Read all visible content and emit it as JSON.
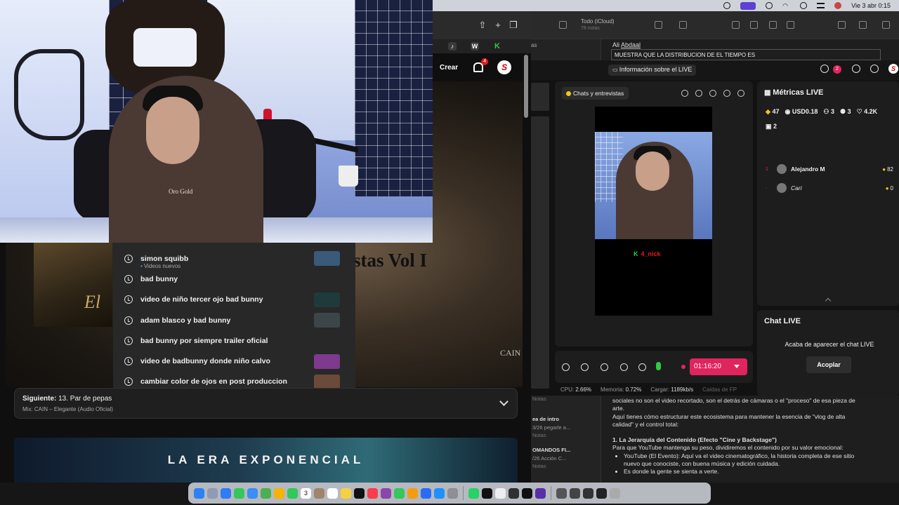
{
  "menubar": {
    "datetime": "Vie 3 abr 0:15"
  },
  "youtube": {
    "create_label": "Crear",
    "notifications_count": "4",
    "avatar_letter": "S",
    "bookmark_w": "W",
    "bookmark_k": "K",
    "suggestions": [
      {
        "text": "simon squibb",
        "sub": "Videos nuevos",
        "thumb": "#3b5a7a"
      },
      {
        "text": "bad bunny",
        "sub": "",
        "thumb": ""
      },
      {
        "text": "video de niño tercer ojo bad bunny",
        "sub": "",
        "thumb": "#1f3a3a"
      },
      {
        "text": "adam blasco y bad bunny",
        "sub": "",
        "thumb": "#3c4648"
      },
      {
        "text": "bad bunny por siempre trailer oficial",
        "sub": "",
        "thumb": ""
      },
      {
        "text": "video de badbunny donde niño calvo",
        "sub": "",
        "thumb": "#7d3a8f"
      },
      {
        "text": "cambiar color de ojos en post produccion",
        "sub": "",
        "thumb": "#6b4a3a"
      }
    ],
    "video_overlay_title": "stas Vol I",
    "video_art_text": "El",
    "video_watermark": "CAIN",
    "next": {
      "label": "Siguiente:",
      "title": "13. Par de pepas",
      "mix": "Mix: CAIN – Elegante (Audio Oficial)"
    },
    "banner_text": "LA ERA EXPONENCIAL"
  },
  "cam": {
    "hoodie_logo": "Oro Gold"
  },
  "notes": {
    "folder_title": "Todo (iCloud)",
    "folder_count": "78 notas",
    "sidebar_partial": "as",
    "author_prefix": "Ali ",
    "author_name": "Abdaal",
    "cell_text": "MUESTRA   QUE LA DISTRIBUCION DE EL TIEMPO ES",
    "list": [
      {
        "title": "",
        "date": "",
        "note": "Notas"
      },
      {
        "title": "ea de intro",
        "date": "3/26  pegarle a...",
        "note": "Notas"
      },
      {
        "title": "OMANDOS FI...",
        "date": "/26  Acción C...",
        "note": "Notas"
      }
    ],
    "body": {
      "p1a": "sociales no son el video recortado, son el detrás de cámaras o el \"proceso\" de esa pieza de",
      "p1b": "arte.",
      "p2a": "Aquí tienes cómo estructurar este ecosistema para mantener la esencia de \"vlog de alta",
      "p2b": "calidad\" y el control total:",
      "h1": "1. La Jerarquía del Contenido (Efecto \"Cine y Backstage\")",
      "p3": "Para que YouTube mantenga su peso, dividiremos el contenido por su valor emocional:",
      "li1a": "YouTube (El Evento): Aquí va el video cinematográfico, la historia completa de ese sitio",
      "li1b": "nuevo que conociste, con buena música y edición cuidada.",
      "li2": "Es donde la gente se sienta a verte."
    }
  },
  "live": {
    "info_label": "Información sobre el LIVE",
    "bell_count": "2",
    "avatar_letter": "S",
    "chip_label": "Chats y entrevistas",
    "preview_tag_k": "K",
    "preview_tag": "4_nick",
    "timer": "01:16:20",
    "stats": {
      "cpu_label": "CPU:",
      "cpu": "2.66%",
      "mem_label": "Memoria:",
      "mem": "0.72%",
      "up_label": "Cargar:",
      "up": "1189kb/s",
      "drop_label": "Caídas de FP"
    },
    "metrics": {
      "title": "Métricas LIVE",
      "diamonds": "47",
      "usd": "USD0.18",
      "viewers": "3",
      "new_followers": "3",
      "likes": "4.2K",
      "gifters": "2",
      "top_viewers": [
        {
          "rank": "1",
          "name": "Alejandro M",
          "score": "82",
          "italic": false
        },
        {
          "rank": "-",
          "name": "Cari",
          "score": "0",
          "italic": true
        }
      ]
    },
    "chat": {
      "title": "Chat LIVE",
      "message": "Acaba de aparecer el chat LIVE",
      "dock_button": "Acoplar"
    }
  },
  "dock": {
    "calendar_day": "3",
    "apps": [
      "finder",
      "launchpad",
      "safari",
      "messages",
      "mail",
      "maps",
      "photos",
      "facetime",
      "calendar",
      "contacts",
      "reminders",
      "notes",
      "appletv",
      "music",
      "podcasts",
      "numbers",
      "pages",
      "keynote",
      "appstore",
      "settings",
      "whatsapp",
      "capcut",
      "chrome",
      "obs",
      "tiktok",
      "vpn",
      "screen1",
      "screen2",
      "screen3",
      "screen4",
      "trash"
    ],
    "app_colors": [
      "#2b82f6",
      "#8f9bb3",
      "#2e7cf6",
      "#34c759",
      "#3a8ef6",
      "#4caf50",
      "#f4b400",
      "#34c759",
      "#ffffff",
      "#a0846b",
      "#ffffff",
      "#f5d142",
      "#111111",
      "#fa3c4c",
      "#8e44ad",
      "#34c759",
      "#f39c12",
      "#2a6cf6",
      "#1e90ff",
      "#8e8e93",
      "#25d366",
      "#111111",
      "#eeeeee",
      "#303030",
      "#111111",
      "#5a2ea6",
      "#555555",
      "#444444",
      "#333333",
      "#222222",
      "#aaaaaa"
    ]
  }
}
